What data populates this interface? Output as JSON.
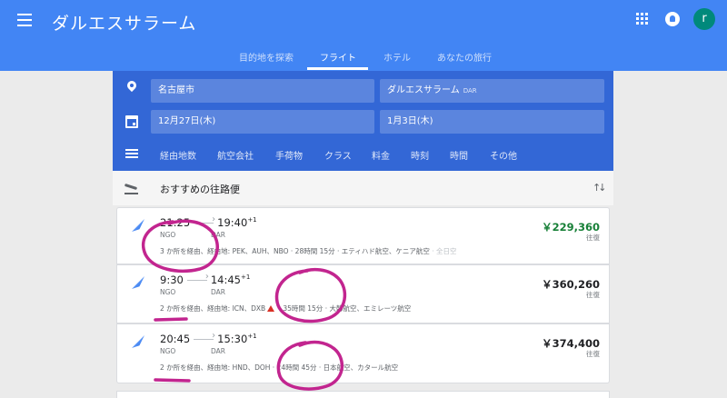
{
  "app": {
    "title": "ダルエスサラーム",
    "avatar_letter": "r",
    "menu_icon": "hamburger-menu-icon",
    "apps_icon": "apps-grid-icon",
    "notification_icon": "bell-icon"
  },
  "tabs": [
    {
      "label": "目的地を探索",
      "active": false
    },
    {
      "label": "フライト",
      "active": true
    },
    {
      "label": "ホテル",
      "active": false
    },
    {
      "label": "あなたの旅行",
      "active": false
    }
  ],
  "search": {
    "origin": "名古屋市",
    "destination": "ダルエスサラーム",
    "destination_code": "DAR",
    "depart_date": "12月27日(木)",
    "return_date": "1月3日(木)"
  },
  "filters": [
    "経由地数",
    "航空会社",
    "手荷物",
    "クラス",
    "料金",
    "時刻",
    "時間",
    "その他"
  ],
  "section": {
    "title": "おすすめの往路便"
  },
  "flights": [
    {
      "depart": "21:25",
      "arrive": "19:40",
      "day_offset": "+1",
      "origin_code": "NGO",
      "dest_code": "DAR",
      "stops_text": "3 か所を経由、経由地: PEK、AUH、NBO · 28時間 15分 · エティハド航空、ケニア航空",
      "extra_airline": " · 全日空",
      "price": "￥229,360",
      "price_note": "往復",
      "price_color": "#188038"
    },
    {
      "depart": "9:30",
      "arrive": "14:45",
      "day_offset": "+1",
      "origin_code": "NGO",
      "dest_code": "DAR",
      "stops_prefix": "2 か所を経由、経由地: ICN、DXB",
      "stops_suffix": " · 35時間 15分 · 大韓航空、エミレーツ航空",
      "price": "￥360,260",
      "price_note": "往復",
      "price_color": "#202124"
    },
    {
      "depart": "20:45",
      "arrive": "15:30",
      "day_offset": "+1",
      "origin_code": "NGO",
      "dest_code": "DAR",
      "stops_text": "2 か所を経由、経由地: HND、DOH · 24時間 45分 · 日本航空、カタール航空",
      "price": "￥374,400",
      "price_note": "往復",
      "price_color": "#202124"
    }
  ],
  "annotation_color": "#c2258f"
}
